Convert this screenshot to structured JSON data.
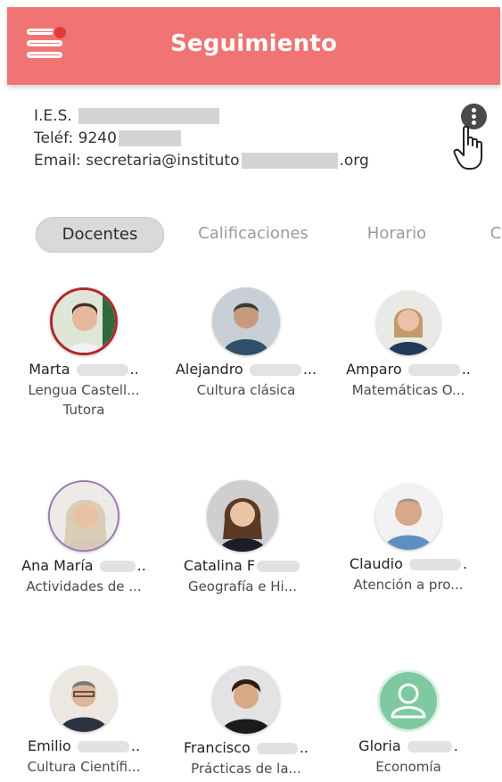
{
  "header": {
    "title": "Seguimiento",
    "menu_icon": "menu-icon",
    "notification_color": "#e53935",
    "bar_color": "#f07473"
  },
  "school": {
    "name_prefix": "I.E.S.",
    "phone_prefix": "Teléf: 9240",
    "email_prefix": "Email: secretaria@instituto",
    "email_suffix": ".org",
    "more_icon": "more-vertical-icon"
  },
  "tabs": [
    {
      "label": "Docentes",
      "active": true
    },
    {
      "label": "Calificaciones",
      "active": false
    },
    {
      "label": "Horario",
      "active": false
    },
    {
      "label": "C",
      "active": false
    }
  ],
  "teachers": [
    {
      "first_name": "Marta",
      "ellipsis": "..",
      "subject": "Lengua Castell...",
      "role": "Tutora"
    },
    {
      "first_name": "Alejandro",
      "ellipsis": "...",
      "subject": "Cultura clásica"
    },
    {
      "first_name": "Amparo",
      "ellipsis": "..",
      "subject": "Matemáticas O..."
    },
    {
      "first_name": "Ana María",
      "ellipsis": "..",
      "subject": "Actividades de ..."
    },
    {
      "first_name": "Catalina F",
      "ellipsis": "",
      "subject": "Geografía e Hi..."
    },
    {
      "first_name": "Claudio",
      "ellipsis": ".",
      "subject": "Atención a pro..."
    },
    {
      "first_name": "Emilio",
      "ellipsis": "..",
      "subject": "Cultura Científi..."
    },
    {
      "first_name": "Francisco",
      "ellipsis": "..",
      "subject": "Prácticas de la..."
    },
    {
      "first_name": "Gloria",
      "ellipsis": ".",
      "subject": "Economía"
    }
  ]
}
